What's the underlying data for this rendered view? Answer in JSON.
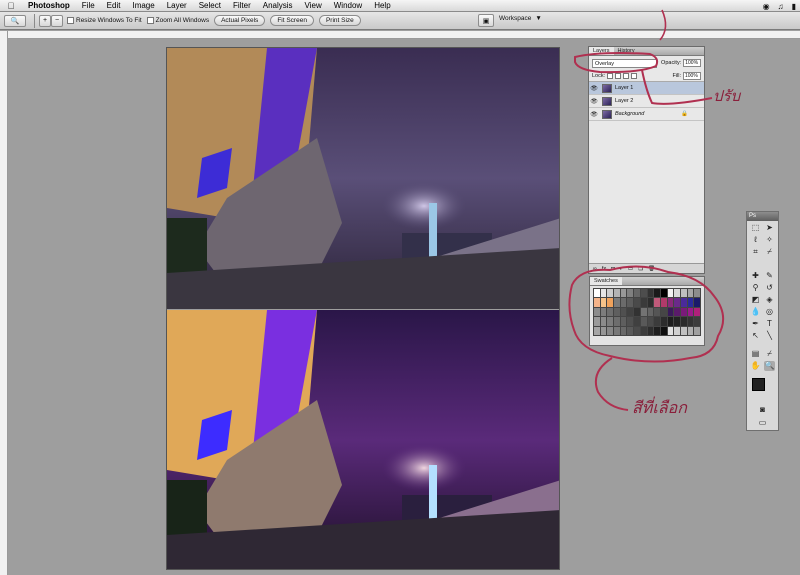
{
  "menubar": {
    "app": "Photoshop",
    "items": [
      "File",
      "Edit",
      "Image",
      "Layer",
      "Select",
      "Filter",
      "Analysis",
      "View",
      "Window",
      "Help"
    ]
  },
  "options": {
    "resize_windows": "Resize Windows To Fit",
    "zoom_all": "Zoom All Windows",
    "actual_pixels": "Actual Pixels",
    "fit_screen": "Fit Screen",
    "print_size": "Print Size",
    "workspace": "Workspace"
  },
  "layers_panel": {
    "tab_layers": "Layers",
    "tab_history": "History",
    "blend_mode": "Overlay",
    "opacity_label": "Opacity:",
    "opacity_value": "100%",
    "lock_label": "Lock:",
    "fill_label": "Fill:",
    "fill_value": "100%",
    "layers": [
      {
        "name": "Layer 1",
        "selected": true
      },
      {
        "name": "Layer 2",
        "selected": false
      },
      {
        "name": "Background",
        "selected": false
      }
    ]
  },
  "swatches_panel": {
    "title": "Swatches",
    "colors": [
      "#ffffff",
      "#e6e6e6",
      "#cccccc",
      "#b3b3b3",
      "#999999",
      "#808080",
      "#666666",
      "#4d4d4d",
      "#333333",
      "#1a1a1a",
      "#000000",
      "#f2f2f2",
      "#d9d9d9",
      "#bfbfbf",
      "#a6a6a6",
      "#8c8c8c",
      "#f5b48a",
      "#f6c38a",
      "#f0a25c",
      "#7a7a7a",
      "#6b6b6b",
      "#5c5c5c",
      "#4a4a4a",
      "#3a3a3a",
      "#2d2d2d",
      "#c05a7a",
      "#b13a6a",
      "#8a2a7a",
      "#6a2a8a",
      "#4a2a9a",
      "#2a2a9a",
      "#1a1a6a",
      "#8c8c8c",
      "#7d7d7d",
      "#6e6e6e",
      "#5f5f5f",
      "#505050",
      "#414141",
      "#323232",
      "#737373",
      "#646464",
      "#555555",
      "#464646",
      "#3a1a5a",
      "#5a1a6a",
      "#7a1a7a",
      "#9a1a8a",
      "#b0207a",
      "#9a9a9a",
      "#8b8b8b",
      "#7c7c7c",
      "#6d6d6d",
      "#5e5e5e",
      "#4f4f4f",
      "#404040",
      "#595959",
      "#4a4a4a",
      "#3b3b3b",
      "#2c2c2c",
      "#1d1d1d",
      "#222222",
      "#2a2a2a",
      "#333333",
      "#3c3c3c",
      "#a5a5a5",
      "#969696",
      "#878787",
      "#787878",
      "#696969",
      "#5a5a5a",
      "#4b4b4b",
      "#3c3c3c",
      "#2d2d2d",
      "#1e1e1e",
      "#0f0f0f",
      "#e0e0e0",
      "#d0d0d0",
      "#c0c0c0",
      "#b0b0b0",
      "#a0a0a0"
    ]
  },
  "toolbox": {
    "title": "Ps"
  },
  "annotations": {
    "adjust": "ปรับ",
    "chosen_color": "สีที่เลือก"
  }
}
